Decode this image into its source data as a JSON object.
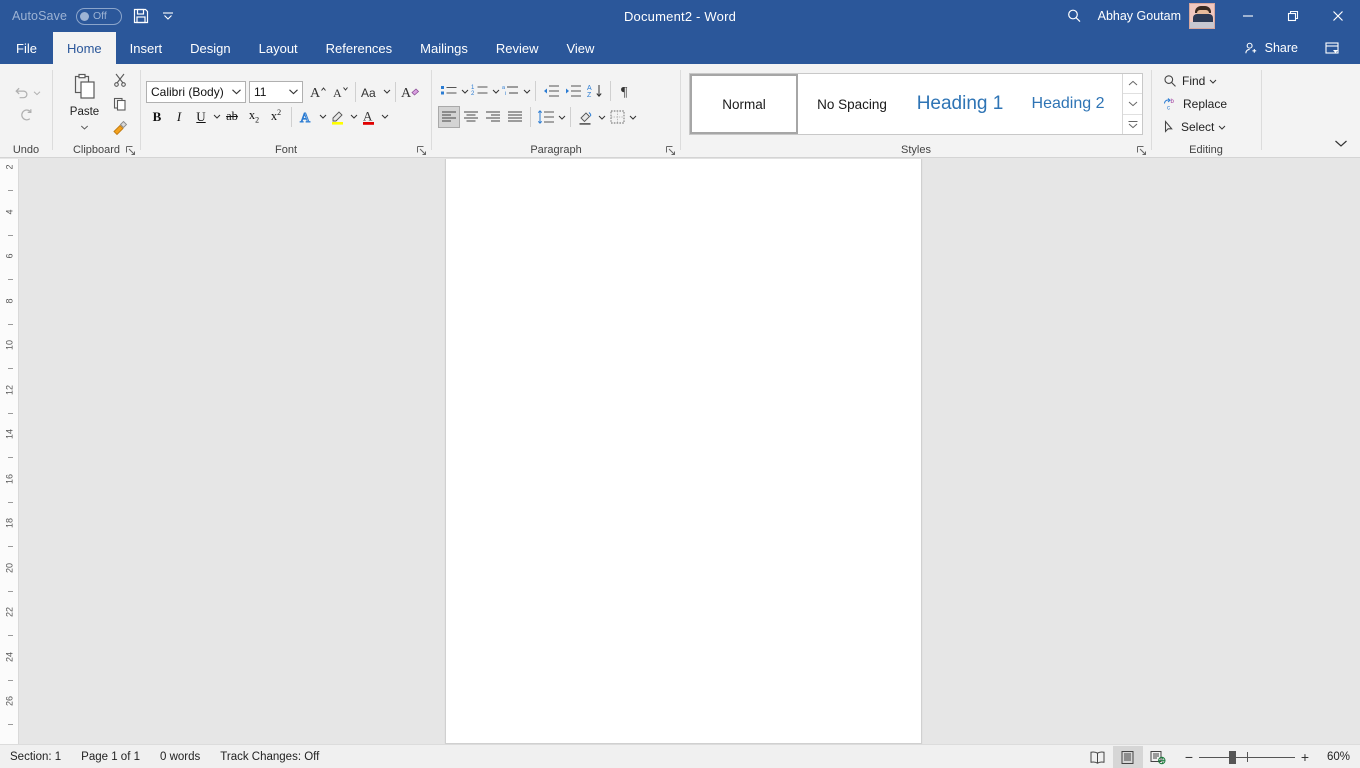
{
  "titlebar": {
    "autosave_label": "AutoSave",
    "autosave_state": "Off",
    "save_icon": "save-icon",
    "qat_more_icon": "chevron-down-icon",
    "document_title": "Document2  -  Word",
    "search_icon": "search-icon",
    "user_name": "Abhay Goutam",
    "avatar_icon": "user-avatar",
    "minimize_icon": "minimize-icon",
    "restore_icon": "restore-icon",
    "close_icon": "close-icon"
  },
  "tabs": [
    {
      "label": "File",
      "active": false
    },
    {
      "label": "Home",
      "active": true
    },
    {
      "label": "Insert",
      "active": false
    },
    {
      "label": "Design",
      "active": false
    },
    {
      "label": "Layout",
      "active": false
    },
    {
      "label": "References",
      "active": false
    },
    {
      "label": "Mailings",
      "active": false
    },
    {
      "label": "Review",
      "active": false
    },
    {
      "label": "View",
      "active": false
    }
  ],
  "share": {
    "label": "Share",
    "icon": "share-person-icon"
  },
  "ribbon_display_options": {
    "icon": "ribbon-display-options-icon"
  },
  "ribbon": {
    "undo": {
      "label": "Undo",
      "undo_icon": "undo-arrow-icon",
      "undo_caret": "chevron-down-icon",
      "redo_icon": "redo-arrow-icon"
    },
    "clipboard": {
      "label": "Clipboard",
      "paste_label": "Paste",
      "paste_icon": "paste-clipboard-icon",
      "paste_caret": "chevron-down-icon",
      "cut_icon": "scissors-icon",
      "copy_icon": "copy-icon",
      "format_painter_icon": "format-painter-icon",
      "dialog_launcher_icon": "dialog-launcher-icon"
    },
    "font": {
      "label": "Font",
      "font_name": "Calibri (Body)",
      "font_size": "11",
      "font_name_caret": "chevron-down-icon",
      "font_size_caret": "chevron-down-icon",
      "grow_font_icon": "grow-font-icon",
      "shrink_font_icon": "shrink-font-icon",
      "change_case_icon": "change-case-icon",
      "change_case_caret": "chevron-down-icon",
      "clear_formatting_icon": "clear-formatting-icon",
      "bold_label": "B",
      "italic_label": "I",
      "underline_label": "U",
      "underline_caret": "chevron-down-icon",
      "strikethrough_label": "ab",
      "subscript_label": "x",
      "subscript_sub": "2",
      "superscript_label": "x",
      "superscript_sup": "2",
      "text_effects_icon": "text-effects-icon",
      "text_effects_caret": "chevron-down-icon",
      "highlight_icon": "text-highlight-icon",
      "highlight_caret": "chevron-down-icon",
      "font_color_icon": "font-color-icon",
      "font_color_caret": "chevron-down-icon",
      "dialog_launcher_icon": "dialog-launcher-icon",
      "highlight_color": "#ffff00",
      "font_color": "#e00000",
      "accent_blue": "#2b7cd3"
    },
    "paragraph": {
      "label": "Paragraph",
      "bullets_icon": "bullet-list-icon",
      "bullets_caret": "chevron-down-icon",
      "numbering_icon": "numbered-list-icon",
      "numbering_caret": "chevron-down-icon",
      "multilevel_icon": "multilevel-list-icon",
      "multilevel_caret": "chevron-down-icon",
      "decrease_indent_icon": "decrease-indent-icon",
      "increase_indent_icon": "increase-indent-icon",
      "sort_icon": "sort-az-icon",
      "show_marks_icon": "pilcrow-icon",
      "align_left_icon": "align-left-icon",
      "align_center_icon": "align-center-icon",
      "align_right_icon": "align-right-icon",
      "justify_icon": "justify-icon",
      "line_spacing_icon": "line-spacing-icon",
      "line_spacing_caret": "chevron-down-icon",
      "shading_icon": "shading-icon",
      "shading_caret": "chevron-down-icon",
      "borders_icon": "borders-icon",
      "borders_caret": "chevron-down-icon",
      "dialog_launcher_icon": "dialog-launcher-icon"
    },
    "styles": {
      "label": "Styles",
      "items": [
        {
          "label": "Normal",
          "selected": true
        },
        {
          "label": "No Spacing",
          "selected": false
        },
        {
          "label": "Heading 1",
          "selected": false
        },
        {
          "label": "Heading 2",
          "selected": false
        }
      ],
      "scroll_up_icon": "chevron-up-icon",
      "scroll_down_icon": "chevron-down-icon",
      "more_icon": "more-styles-icon",
      "dialog_launcher_icon": "dialog-launcher-icon"
    },
    "editing": {
      "label": "Editing",
      "find_label": "Find",
      "find_icon": "search-icon",
      "find_caret": "chevron-down-icon",
      "replace_label": "Replace",
      "replace_icon": "replace-icon",
      "select_label": "Select",
      "select_icon": "cursor-arrow-icon",
      "select_caret": "chevron-down-icon"
    },
    "collapse_icon": "chevron-up-collapse-icon"
  },
  "ruler": {
    "numbers": [
      "2",
      "4",
      "6",
      "8",
      "10",
      "12",
      "14",
      "16",
      "18",
      "20",
      "22",
      "24",
      "26"
    ]
  },
  "statusbar": {
    "section": "Section: 1",
    "page": "Page 1 of 1",
    "words": "0 words",
    "track_changes": "Track Changes: Off",
    "read_mode_icon": "read-mode-icon",
    "print_layout_icon": "print-layout-icon",
    "web_layout_icon": "web-layout-icon",
    "zoom_out_label": "−",
    "zoom_in_label": "+",
    "zoom_level": "60%"
  }
}
